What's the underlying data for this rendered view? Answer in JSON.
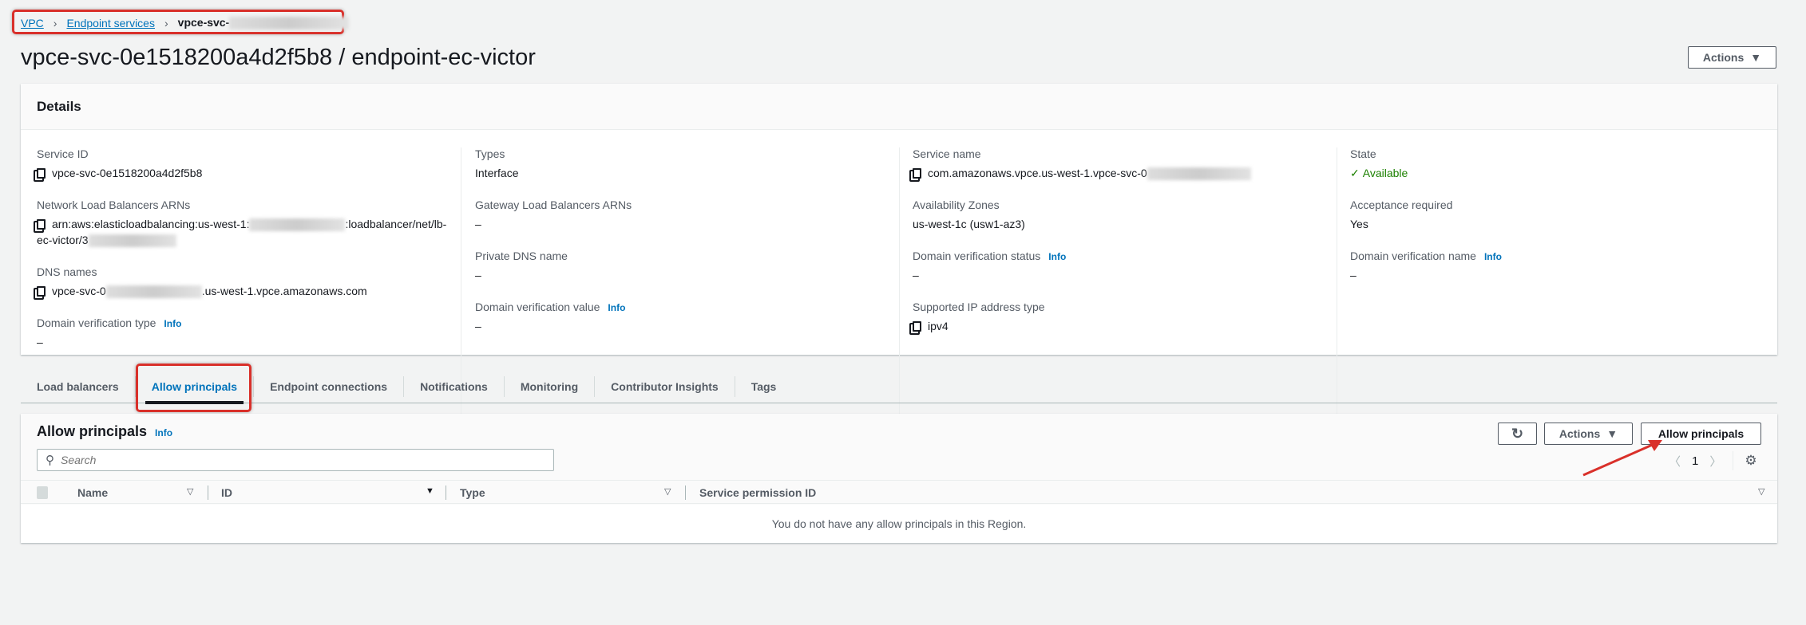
{
  "breadcrumb": [
    {
      "label": "VPC"
    },
    {
      "label": "Endpoint services"
    },
    {
      "label": "vpce-svc-"
    }
  ],
  "title": "vpce-svc-0e1518200a4d2f5b8 / endpoint-ec-victor",
  "header_actions": "Actions",
  "details": {
    "title": "Details",
    "info_label": "Info",
    "columns": [
      [
        {
          "label": "Service ID",
          "value": "vpce-svc-0e1518200a4d2f5b8",
          "copy": true
        },
        {
          "label": "Network Load Balancers ARNs",
          "value": "arn:aws:elasticloadbalancing:us-west-1:",
          "value2": ":loadbalancer/net/lb-",
          "value3": "ec-victor/3",
          "copy": true
        },
        {
          "label": "DNS names",
          "value": "vpce-svc-0",
          "value2": ".us-west-1.vpce.amazonaws.com",
          "copy": true
        },
        {
          "label": "Domain verification type",
          "value": "–",
          "info": true
        }
      ],
      [
        {
          "label": "Types",
          "value": "Interface"
        },
        {
          "label": "Gateway Load Balancers ARNs",
          "value": "–"
        },
        {
          "label": "Private DNS name",
          "value": "–"
        },
        {
          "label": "Domain verification value",
          "value": "–",
          "info": true
        }
      ],
      [
        {
          "label": "Service name",
          "value": "com.amazonaws.vpce.us-west-1.vpce-svc-0",
          "copy": true
        },
        {
          "label": "Availability Zones",
          "value": "us-west-1c (usw1-az3)"
        },
        {
          "label": "Domain verification status",
          "value": "–",
          "info": true
        },
        {
          "label": "Supported IP address type",
          "value": "ipv4",
          "copy": true
        }
      ],
      [
        {
          "label": "State",
          "value": "Available",
          "status_color": "#1d8102"
        },
        {
          "label": "Acceptance required",
          "value": "Yes"
        },
        {
          "label": "Domain verification name",
          "value": "–",
          "info": true
        }
      ]
    ]
  },
  "tabs": [
    {
      "label": "Load balancers"
    },
    {
      "label": "Allow principals",
      "active": true
    },
    {
      "label": "Endpoint connections"
    },
    {
      "label": "Notifications"
    },
    {
      "label": "Monitoring"
    },
    {
      "label": "Contributor Insights"
    },
    {
      "label": "Tags"
    }
  ],
  "principals": {
    "title": "Allow principals",
    "info": "Info",
    "actions": "Actions",
    "allow_button": "Allow principals",
    "search_placeholder": "Search",
    "page": "1",
    "columns": [
      "Name",
      "ID",
      "Type",
      "Service permission ID"
    ],
    "empty": "You do not have any allow principals in this Region."
  },
  "colors": {
    "accent": "#0073bb",
    "annotation": "#d9302a",
    "success": "#1d8102"
  }
}
